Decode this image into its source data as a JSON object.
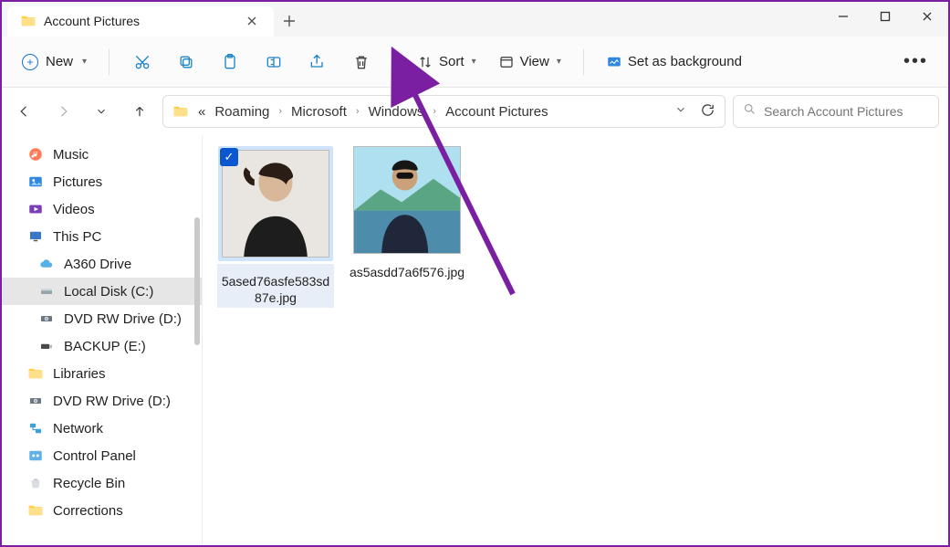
{
  "window": {
    "tab_title": "Account Pictures"
  },
  "toolbar": {
    "new_label": "New",
    "sort_label": "Sort",
    "view_label": "View",
    "set_bg_label": "Set as background"
  },
  "breadcrumb": {
    "prefix": "«",
    "parts": [
      "Roaming",
      "Microsoft",
      "Windows",
      "Account Pictures"
    ]
  },
  "search": {
    "placeholder": "Search Account Pictures"
  },
  "sidebar": {
    "items": [
      {
        "label": "Music",
        "icon": "music",
        "level": 1
      },
      {
        "label": "Pictures",
        "icon": "pictures",
        "level": 1
      },
      {
        "label": "Videos",
        "icon": "videos",
        "level": 1
      },
      {
        "label": "This PC",
        "icon": "pc",
        "level": 1
      },
      {
        "label": "A360 Drive",
        "icon": "cloud",
        "level": 2
      },
      {
        "label": "Local Disk (C:)",
        "icon": "disk",
        "level": 2,
        "selected": true
      },
      {
        "label": "DVD RW Drive (D:)",
        "icon": "dvd",
        "level": 2
      },
      {
        "label": "BACKUP (E:)",
        "icon": "usb",
        "level": 2
      },
      {
        "label": "Libraries",
        "icon": "folder",
        "level": 1
      },
      {
        "label": "DVD RW Drive (D:)",
        "icon": "dvd",
        "level": 1
      },
      {
        "label": "Network",
        "icon": "network",
        "level": 1
      },
      {
        "label": "Control Panel",
        "icon": "control",
        "level": 1
      },
      {
        "label": "Recycle Bin",
        "icon": "recycle",
        "level": 1
      },
      {
        "label": "Corrections",
        "icon": "folder",
        "level": 1
      }
    ]
  },
  "files": [
    {
      "name": "5ased76asfe583sd87e.jpg",
      "selected": true
    },
    {
      "name": "as5asdd7a6f576.jpg",
      "selected": false
    }
  ]
}
